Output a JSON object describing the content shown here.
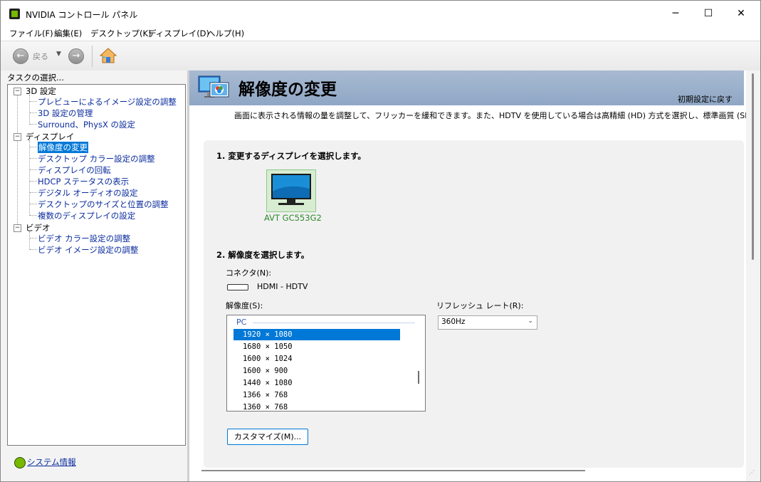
{
  "window": {
    "title": "NVIDIA コントロール パネル",
    "controls": {
      "minimize": "─",
      "maximize": "☐",
      "close": "✕"
    }
  },
  "menubar": [
    "ファイル(F)",
    "編集(E)",
    "デスクトップ(K)",
    "ディスプレイ(D)",
    "ヘルプ(H)"
  ],
  "toolbar": {
    "back_label": "戻る",
    "back_icon": "←",
    "forward_icon": "→",
    "dropdown": "▼"
  },
  "sidebar": {
    "title": "タスクの選択...",
    "categories": [
      {
        "label": "3D 設定",
        "expander": "−",
        "items": [
          "プレビューによるイメージ設定の調整",
          "3D 設定の管理",
          "Surround、PhysX の設定"
        ]
      },
      {
        "label": "ディスプレイ",
        "expander": "−",
        "items": [
          "解像度の変更",
          "デスクトップ カラー設定の調整",
          "ディスプレイの回転",
          "HDCP ステータスの表示",
          "デジタル オーディオの設定",
          "デスクトップのサイズと位置の調整",
          "複数のディスプレイの設定"
        ]
      },
      {
        "label": "ビデオ",
        "expander": "−",
        "items": [
          "ビデオ カラー設定の調整",
          "ビデオ イメージ設定の調整"
        ]
      }
    ],
    "selected_item": "解像度の変更",
    "system_info": "システム情報"
  },
  "main": {
    "title": "解像度の変更",
    "reset_link": "初期設定に戻す",
    "description": "画面に表示される情報の量を調整して、フリッカーを緩和できます。また、HDTV を使用している場合は高精細 (HD) 方式を選択し、標準画質 (SD) TV",
    "step1_title": "1. 変更するディスプレイを選択します。",
    "display_name": "AVT GC553G2",
    "step2_title": "2. 解像度を選択します。",
    "connector_label": "コネクタ(N):",
    "connector_value": "HDMI - HDTV",
    "resolution_label": "解像度(S):",
    "resolution_group": "PC",
    "resolutions": [
      "1920 × 1080",
      "1680 × 1050",
      "1600 × 1024",
      "1600 × 900",
      "1440 × 1080",
      "1366 × 768",
      "1360 × 768"
    ],
    "selected_resolution": "1920 × 1080",
    "refresh_label": "リフレッシュ レート(R):",
    "refresh_value": "360Hz",
    "customize_button": "カスタマイズ(M)..."
  },
  "colors": {
    "header_band": "#9fb3cf",
    "selection": "#0078d7",
    "link": "#0b2c9e",
    "nvidia_green": "#76b900"
  }
}
